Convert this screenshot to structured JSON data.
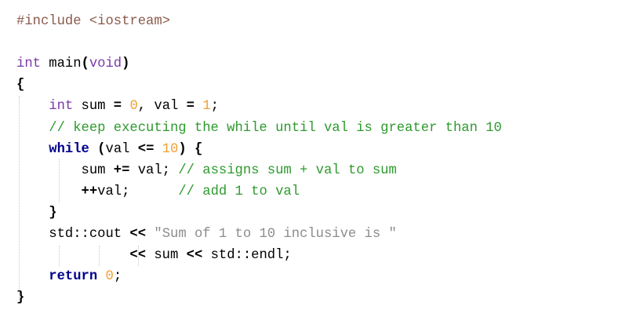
{
  "editor": {
    "lines": [
      [
        {
          "t": "#include <iostream>",
          "c": "pre"
        }
      ],
      [],
      [
        {
          "t": "int",
          "c": "type"
        },
        {
          "t": " main",
          "c": "id"
        },
        {
          "t": "(",
          "c": "op"
        },
        {
          "t": "void",
          "c": "type"
        },
        {
          "t": ")",
          "c": "op"
        }
      ],
      [
        {
          "t": "{",
          "c": "op"
        }
      ],
      [
        {
          "t": "    ",
          "c": "id"
        },
        {
          "t": "int",
          "c": "type"
        },
        {
          "t": " sum ",
          "c": "id"
        },
        {
          "t": "=",
          "c": "op"
        },
        {
          "t": " ",
          "c": "id"
        },
        {
          "t": "0",
          "c": "num"
        },
        {
          "t": ", val ",
          "c": "id"
        },
        {
          "t": "=",
          "c": "op"
        },
        {
          "t": " ",
          "c": "id"
        },
        {
          "t": "1",
          "c": "num"
        },
        {
          "t": ";",
          "c": "id"
        }
      ],
      [
        {
          "t": "    ",
          "c": "id"
        },
        {
          "t": "// keep executing the while until val is greater than 10",
          "c": "cmt"
        }
      ],
      [
        {
          "t": "    ",
          "c": "id"
        },
        {
          "t": "while",
          "c": "kw"
        },
        {
          "t": " ",
          "c": "id"
        },
        {
          "t": "(",
          "c": "op"
        },
        {
          "t": "val ",
          "c": "id"
        },
        {
          "t": "<=",
          "c": "op"
        },
        {
          "t": " ",
          "c": "id"
        },
        {
          "t": "10",
          "c": "num"
        },
        {
          "t": ")",
          "c": "op"
        },
        {
          "t": " ",
          "c": "id"
        },
        {
          "t": "{",
          "c": "op"
        }
      ],
      [
        {
          "t": "        sum ",
          "c": "id"
        },
        {
          "t": "+=",
          "c": "op"
        },
        {
          "t": " val; ",
          "c": "id"
        },
        {
          "t": "// assigns sum + val to sum",
          "c": "cmt"
        }
      ],
      [
        {
          "t": "        ",
          "c": "id"
        },
        {
          "t": "++",
          "c": "op"
        },
        {
          "t": "val;      ",
          "c": "id"
        },
        {
          "t": "// add 1 to val",
          "c": "cmt"
        }
      ],
      [
        {
          "t": "    ",
          "c": "id"
        },
        {
          "t": "}",
          "c": "op"
        }
      ],
      [
        {
          "t": "    std::cout ",
          "c": "id"
        },
        {
          "t": "<<",
          "c": "op"
        },
        {
          "t": " ",
          "c": "id"
        },
        {
          "t": "\"Sum of 1 to 10 inclusive is \"",
          "c": "str"
        }
      ],
      [
        {
          "t": "              ",
          "c": "id"
        },
        {
          "t": "<<",
          "c": "op"
        },
        {
          "t": " sum ",
          "c": "id"
        },
        {
          "t": "<<",
          "c": "op"
        },
        {
          "t": " std::endl;",
          "c": "id"
        }
      ],
      [
        {
          "t": "    ",
          "c": "id"
        },
        {
          "t": "return",
          "c": "kw"
        },
        {
          "t": " ",
          "c": "id"
        },
        {
          "t": "0",
          "c": "num"
        },
        {
          "t": ";",
          "c": "id"
        }
      ],
      [
        {
          "t": "}",
          "c": "op"
        }
      ]
    ]
  },
  "colors": {
    "background": "#ffffff",
    "preprocessor": "#8a5a4a",
    "type": "#7a3aa8",
    "keyword": "#00008b",
    "number": "#f0a030",
    "comment": "#2e9a2e",
    "string": "#8c8c8c"
  }
}
